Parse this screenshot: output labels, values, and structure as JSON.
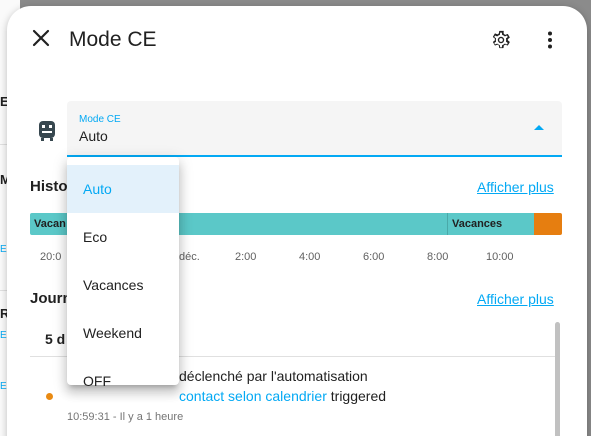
{
  "background": {
    "rows": [
      {
        "text": "Et",
        "type": "bold"
      },
      {
        "text": "M",
        "type": "bold"
      },
      {
        "text": "Re",
        "type": "bold"
      }
    ],
    "links": [
      "E",
      "E",
      "E"
    ]
  },
  "dialog": {
    "title": "Mode CE",
    "close_icon": "close-icon",
    "settings_icon": "gear-icon",
    "more_icon": "more-vertical-icon"
  },
  "select": {
    "label": "Mode CE",
    "value": "Auto",
    "entity_icon": "water-heater-icon"
  },
  "history": {
    "title": "Histo",
    "show_more": "Afficher plus",
    "segments": [
      {
        "label": "Vacan",
        "color": "#5bc8c8"
      },
      {
        "label": "Vacances",
        "color": "#5bc8c8"
      },
      {
        "label": "",
        "color": "#e67e10"
      }
    ],
    "axis": [
      "20:0",
      "déc.",
      "2:00",
      "4:00",
      "6:00",
      "8:00",
      "10:00"
    ]
  },
  "logbook": {
    "title": "Journ",
    "show_more": "Afficher plus",
    "date": "5 d",
    "entry": {
      "line1_text": "déclenché par l'automatisation",
      "line2_link": "contact selon calendrier",
      "line2_suffix": " triggered",
      "time": "10:59:31 - Il y a 1 heure",
      "dot_color": "#e98a12"
    }
  },
  "menu": {
    "options": [
      "Auto",
      "Eco",
      "Vacances",
      "Weekend",
      "OFF"
    ],
    "selected": "Auto"
  },
  "colors": {
    "accent": "#03a9f4",
    "timeline_primary": "#5bc8c8",
    "timeline_secondary": "#e67e10"
  }
}
